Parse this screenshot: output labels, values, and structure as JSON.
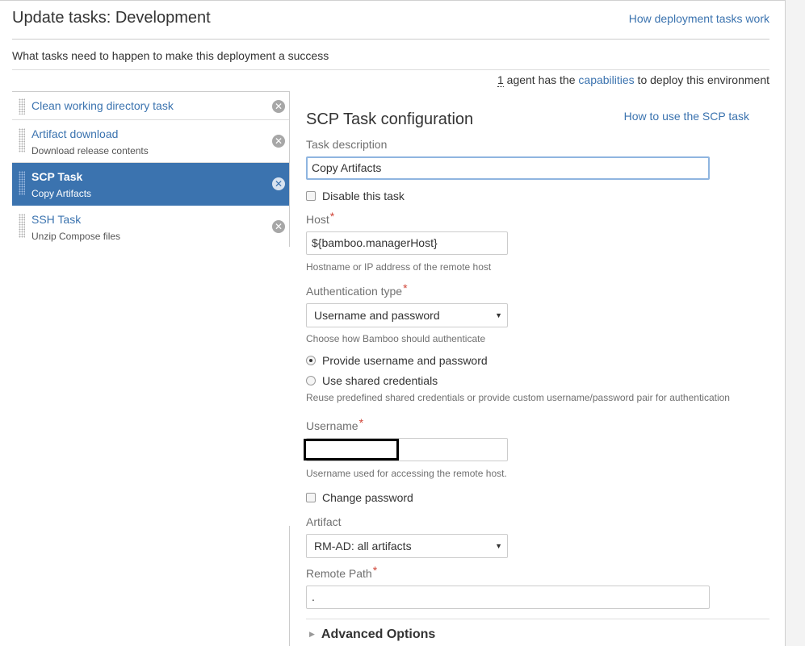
{
  "header": {
    "title": "Update tasks: Development",
    "help_link": "How deployment tasks work",
    "subtitle": "What tasks need to happen to make this deployment a success",
    "agents_count": "1",
    "agents_prefix": " agent has the ",
    "agents_link": "capabilities",
    "agents_suffix": " to deploy this environment"
  },
  "tasks": [
    {
      "name": "Clean working directory task",
      "desc": "",
      "active": false
    },
    {
      "name": "Artifact download",
      "desc": "Download release contents",
      "active": false
    },
    {
      "name": "SCP Task",
      "desc": "Copy Artifacts",
      "active": true
    },
    {
      "name": "SSH Task",
      "desc": "Unzip Compose files",
      "active": false
    }
  ],
  "config": {
    "title": "SCP Task configuration",
    "help_link": "How to use the SCP task",
    "task_description_label": "Task description",
    "task_description_value": "Copy Artifacts",
    "disable_label": "Disable this task",
    "host_label": "Host",
    "host_value": "${bamboo.managerHost}",
    "host_help": "Hostname or IP address of the remote host",
    "auth_label": "Authentication type",
    "auth_value": "Username and password",
    "auth_help": "Choose how Bamboo should authenticate",
    "radio_provide": "Provide username and password",
    "radio_shared": "Use shared credentials",
    "radio_help": "Reuse predefined shared credentials or provide custom username/password pair for authentication",
    "username_label": "Username",
    "username_value": "",
    "username_help": "Username used for accessing the remote host.",
    "change_password_label": "Change password",
    "artifact_label": "Artifact",
    "artifact_value": "RM-AD: all artifacts",
    "remote_path_label": "Remote Path",
    "remote_path_value": ".",
    "advanced_label": "Advanced Options",
    "required_mark": "*"
  },
  "colors": {
    "link": "#3b73af",
    "active_task": "#3b73af",
    "required": "#d04437"
  }
}
